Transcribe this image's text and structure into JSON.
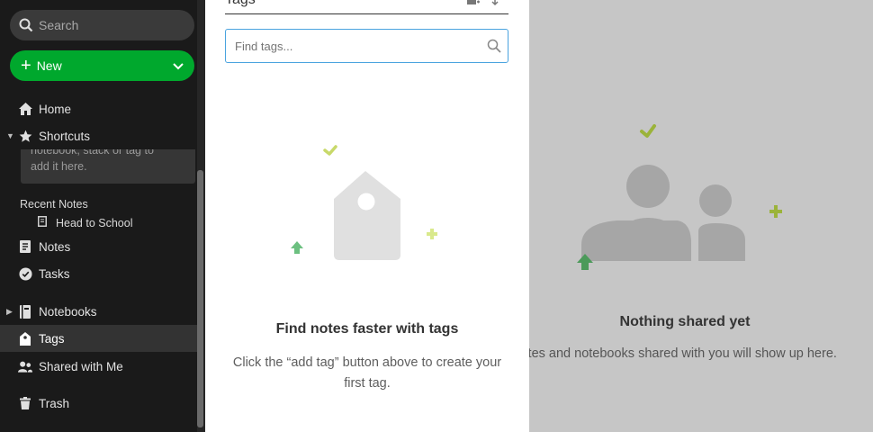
{
  "colors": {
    "sidebar_bg": "#1a1a1a",
    "accent_green": "#00a82d",
    "active_item_bg": "#333333",
    "focus_blue": "#4aa3df",
    "overlay_gray": "#c6c6c6"
  },
  "sidebar": {
    "search_placeholder": "Search",
    "new_label": "New",
    "items": {
      "home": "Home",
      "shortcuts": "Shortcuts",
      "notes": "Notes",
      "tasks": "Tasks",
      "notebooks": "Notebooks",
      "tags": "Tags",
      "shared": "Shared with Me",
      "trash": "Trash"
    },
    "shortcut_tip_line1": "notebook, stack or tag to",
    "shortcut_tip_line2": "add it here.",
    "recent_heading": "Recent Notes",
    "recent_items": [
      "Head to School"
    ]
  },
  "tags_panel": {
    "title": "Tags",
    "find_placeholder": "Find tags...",
    "empty_title": "Find notes faster with tags",
    "empty_text": "Click the “add tag” button above to create your first tag."
  },
  "shared_panel": {
    "empty_title": "Nothing shared yet",
    "empty_text": "Notes and notebooks shared with you will show up here."
  }
}
